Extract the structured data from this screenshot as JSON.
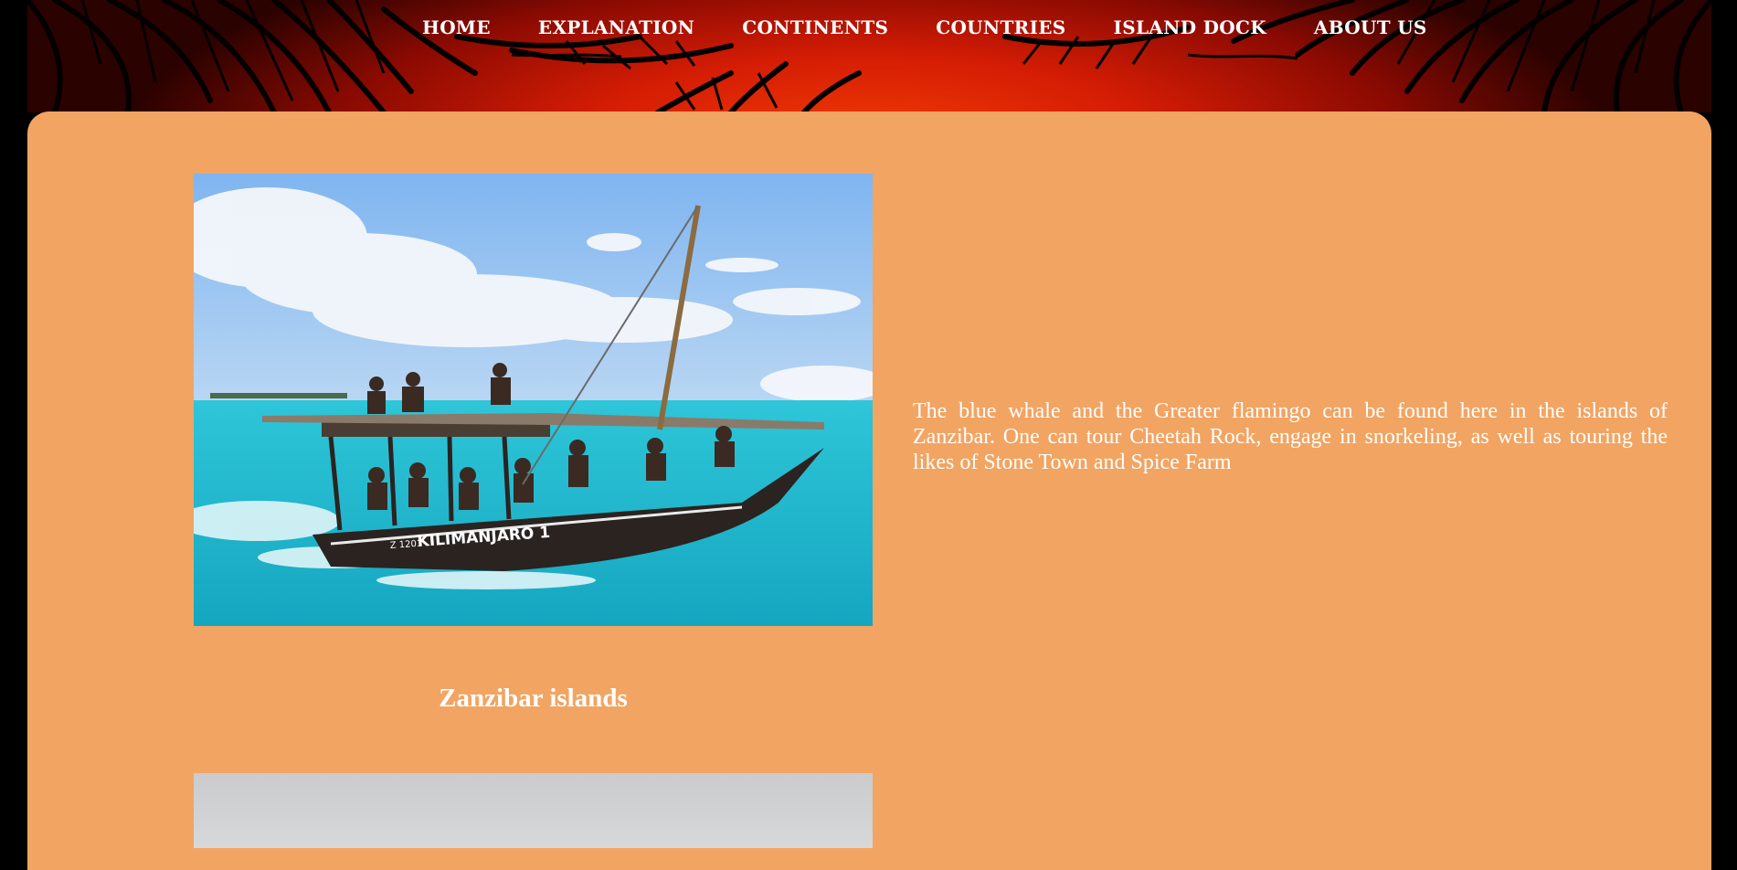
{
  "nav": {
    "items": [
      {
        "label": "HOME"
      },
      {
        "label": "EXPLANATION"
      },
      {
        "label": "CONTINENTS"
      },
      {
        "label": "COUNTRIES"
      },
      {
        "label": "ISLAND DOCK"
      },
      {
        "label": "ABOUT US"
      }
    ]
  },
  "island": {
    "description": "The blue whale and the Greater flamingo can be found here in the islands of Zanzibar. One can tour Cheetah Rock, engage in snorkeling, as well as touring the likes of Stone Town and Spice Farm",
    "caption": "Zanzibar islands",
    "boat_label": "KILIMANJARO 1",
    "boat_id": "Z 1201"
  },
  "colors": {
    "panel": "#f2a462",
    "header_sunset": "#f23a05",
    "text": "#ffffff"
  }
}
